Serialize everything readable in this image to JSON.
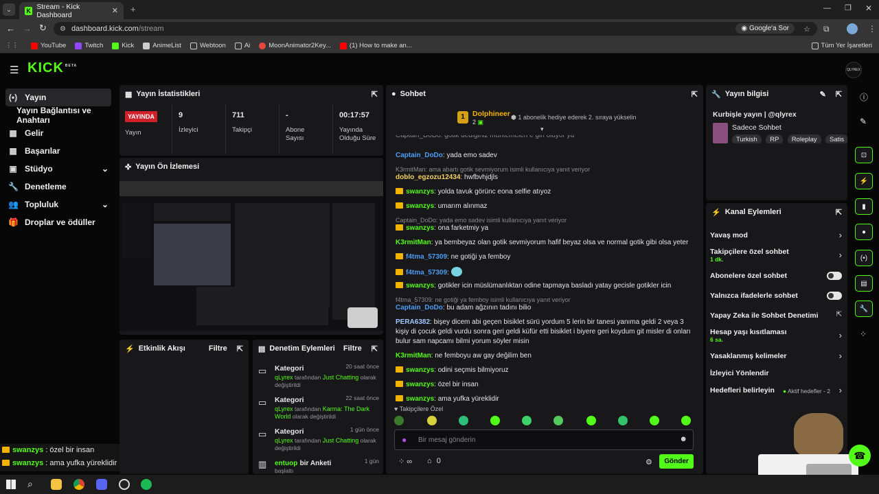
{
  "browser": {
    "tab_title": "Stream - Kick Dashboard",
    "url_host": "dashboard.kick.com",
    "url_path": "/stream",
    "google_ask": "Google'a Sor",
    "bookmarks": [
      "YouTube",
      "Twitch",
      "Kick",
      "AnimeList",
      "Webtoon",
      "Ai",
      "MoonAnimator2Key...",
      "(1) How to make an..."
    ],
    "all_bookmarks": "Tüm Yer İşaretleri"
  },
  "header": {
    "logo": "KICK",
    "beta": "BETA",
    "avatar": "QLYREX"
  },
  "sidebar": {
    "items": [
      "Yayın",
      "Yayın Bağlantısı ve Anahtarı",
      "Gelir",
      "Başarılar",
      "Stüdyo",
      "Denetleme",
      "Topluluk",
      "Droplar ve ödüller"
    ]
  },
  "stats": {
    "title": "Yayın İstatistikleri",
    "badge": "YAYINDA",
    "badge_label": "Yayın",
    "viewers": "9",
    "viewers_label": "İzleyici",
    "followers": "711",
    "followers_label": "Takipçi",
    "subs": "-",
    "subs_label": "Abone Sayısı",
    "uptime": "00:17:57",
    "uptime_label": "Yayında Olduğu Süre"
  },
  "preview": {
    "title": "Yayın Ön İzlemesi"
  },
  "activity": {
    "title": "Etkinlik Akışı",
    "filter": "Filtre"
  },
  "modlog": {
    "title": "Denetim Eylemleri",
    "filter": "Filtre",
    "entries": [
      {
        "title": "Kategori",
        "time": "20 saat önce",
        "user": "qLyrex",
        "mid": " tarafından ",
        "cat": "Just Chatting",
        "end": " olarak değiştirildi"
      },
      {
        "title": "Kategori",
        "time": "22 saat önce",
        "user": "qLyrex",
        "mid": " tarafından ",
        "cat": "Karma: The Dark World",
        "end": " olarak değiştirildi"
      },
      {
        "title": "Kategori",
        "time": "1 gün önce",
        "user": "qLyrex",
        "mid": " tarafından ",
        "cat": "Just Chatting",
        "end": " olarak değiştirildi"
      },
      {
        "title": "bir Anketi",
        "user": "entuop",
        "time": "1 gün",
        "end": "başlattı"
      }
    ]
  },
  "chat": {
    "title": "Sohbet",
    "gifter": "Dolphineer",
    "gifter_rank": "1",
    "gifter_count": "2",
    "gift_note": "1 abonelik hediye ederek 2. sıraya yükselin",
    "cut_line": "Captain_DoDo: gotik dediğiniz muhtemelen e gin oluyor ya",
    "messages": [
      {
        "type": "msg",
        "user": "Captain_DoDo",
        "text": "yada emo sadev",
        "color": "#4a9df5"
      },
      {
        "type": "reply",
        "text": "K3rmitMan: ama abartı gotik sevmiyorum isimli kullanıcıya yanıt veriyor"
      },
      {
        "type": "msg",
        "user": "doblo_egzozu12434",
        "text": "hwfbvhjdjls",
        "color": "#f4d35e"
      },
      {
        "type": "msg",
        "user": "swanzys",
        "text": "yolda tavuk görünc eona selfie atıyoz",
        "color": "#53fc18",
        "crown": true
      },
      {
        "type": "msg",
        "user": "swanzys",
        "text": "umarım alınmaz",
        "color": "#53fc18",
        "crown": true
      },
      {
        "type": "reply",
        "text": "Captain_DoDo: yada emo sadev isimli kullanıcıya yanıt veriyor"
      },
      {
        "type": "msg",
        "user": "swanzys",
        "text": "ona farketmiy ya",
        "color": "#53fc18",
        "crown": true
      },
      {
        "type": "msg",
        "user": "K3rmitMan",
        "text": "ya bembeyaz olan gotik sevmiyorum hafif beyaz olsa ve normal gotik gibi olsa yeter",
        "color": "#53fc18"
      },
      {
        "type": "msg",
        "user": "f4tma_57309",
        "text": "ne gotiği ya femboy",
        "color": "#4a9df5",
        "crown": true
      },
      {
        "type": "msg",
        "user": "f4tma_57309",
        "text": "",
        "color": "#4a9df5",
        "crown": true,
        "emote": true
      },
      {
        "type": "msg",
        "user": "swanzys",
        "text": "gotikler icin müslümanlıktan odine tapmaya basladı yatay gecisle gotikler icin",
        "color": "#53fc18",
        "crown": true
      },
      {
        "type": "reply",
        "text": "f4tma_57309: ne gotiği ya femboy isimli kullanıcıya yanıt veriyor"
      },
      {
        "type": "msg",
        "user": "Captain_DoDo",
        "text": "bu adam ağzının tadını bilio",
        "color": "#4a9df5"
      },
      {
        "type": "msg",
        "user": "PERA6382",
        "text": "bişey dicem abi geçen bisiklet sürü yordum 5 lerin bir tanesi yanıma geldi 2 veya 3 kişiy di çocuk geldi vurdu sonra geri geldi küfür etti bisiklet i biyere geri koydum git misler di onları bulur sam napcamı bilmi yorum söyler misin",
        "color": "#a0c8ff"
      },
      {
        "type": "msg",
        "user": "K3rmitMan",
        "text": "ne femboyu aw gay değilim ben",
        "color": "#53fc18"
      },
      {
        "type": "msg",
        "user": "swanzys",
        "text": "odini seçmis bilmiyoruz",
        "color": "#53fc18",
        "crown": true
      },
      {
        "type": "msg",
        "user": "swanzys",
        "text": "özel bir insan",
        "color": "#53fc18",
        "crown": true
      },
      {
        "type": "msg",
        "user": "swanzys",
        "text": "ama yufka yüreklidir",
        "color": "#53fc18",
        "crown": true
      }
    ],
    "followers_only": "Takipçilere Özel",
    "placeholder": "Bir mesaj gönderin",
    "send": "Gönder",
    "infinity": "∞",
    "gift_count": "0"
  },
  "overlay": [
    {
      "user": "swanzys",
      "text": "özel bir insan"
    },
    {
      "user": "swanzys",
      "text": "ama yufka yüreklidir"
    }
  ],
  "streaminfo": {
    "title": "Yayın bilgisi",
    "stream_title": "Kurbişle yayın | @qlyrex",
    "category": "Sadece Sohbet",
    "tags": [
      "Turkish",
      "RP",
      "Roleplay",
      "Satis"
    ]
  },
  "channel": {
    "title": "Kanal Eylemleri",
    "slow": "Yavaş mod",
    "followers_chat": "Takipçilere özel sohbet",
    "followers_sub": "1 dk.",
    "subs_chat": "Abonelere özel sohbet",
    "emote_chat": "Yalnızca ifadelerle sohbet",
    "ai_mod": "Yapay Zeka ile Sohbet Denetimi",
    "account_age": "Hesap yaşı kısıtlaması",
    "account_sub": "6 sa.",
    "banned_words": "Yasaklanmış kelimeler",
    "redirect": "İzleyici Yönlendir",
    "goals": "Hedefleri belirleyin",
    "goals_sub": "Aktif hedefler - 2"
  }
}
